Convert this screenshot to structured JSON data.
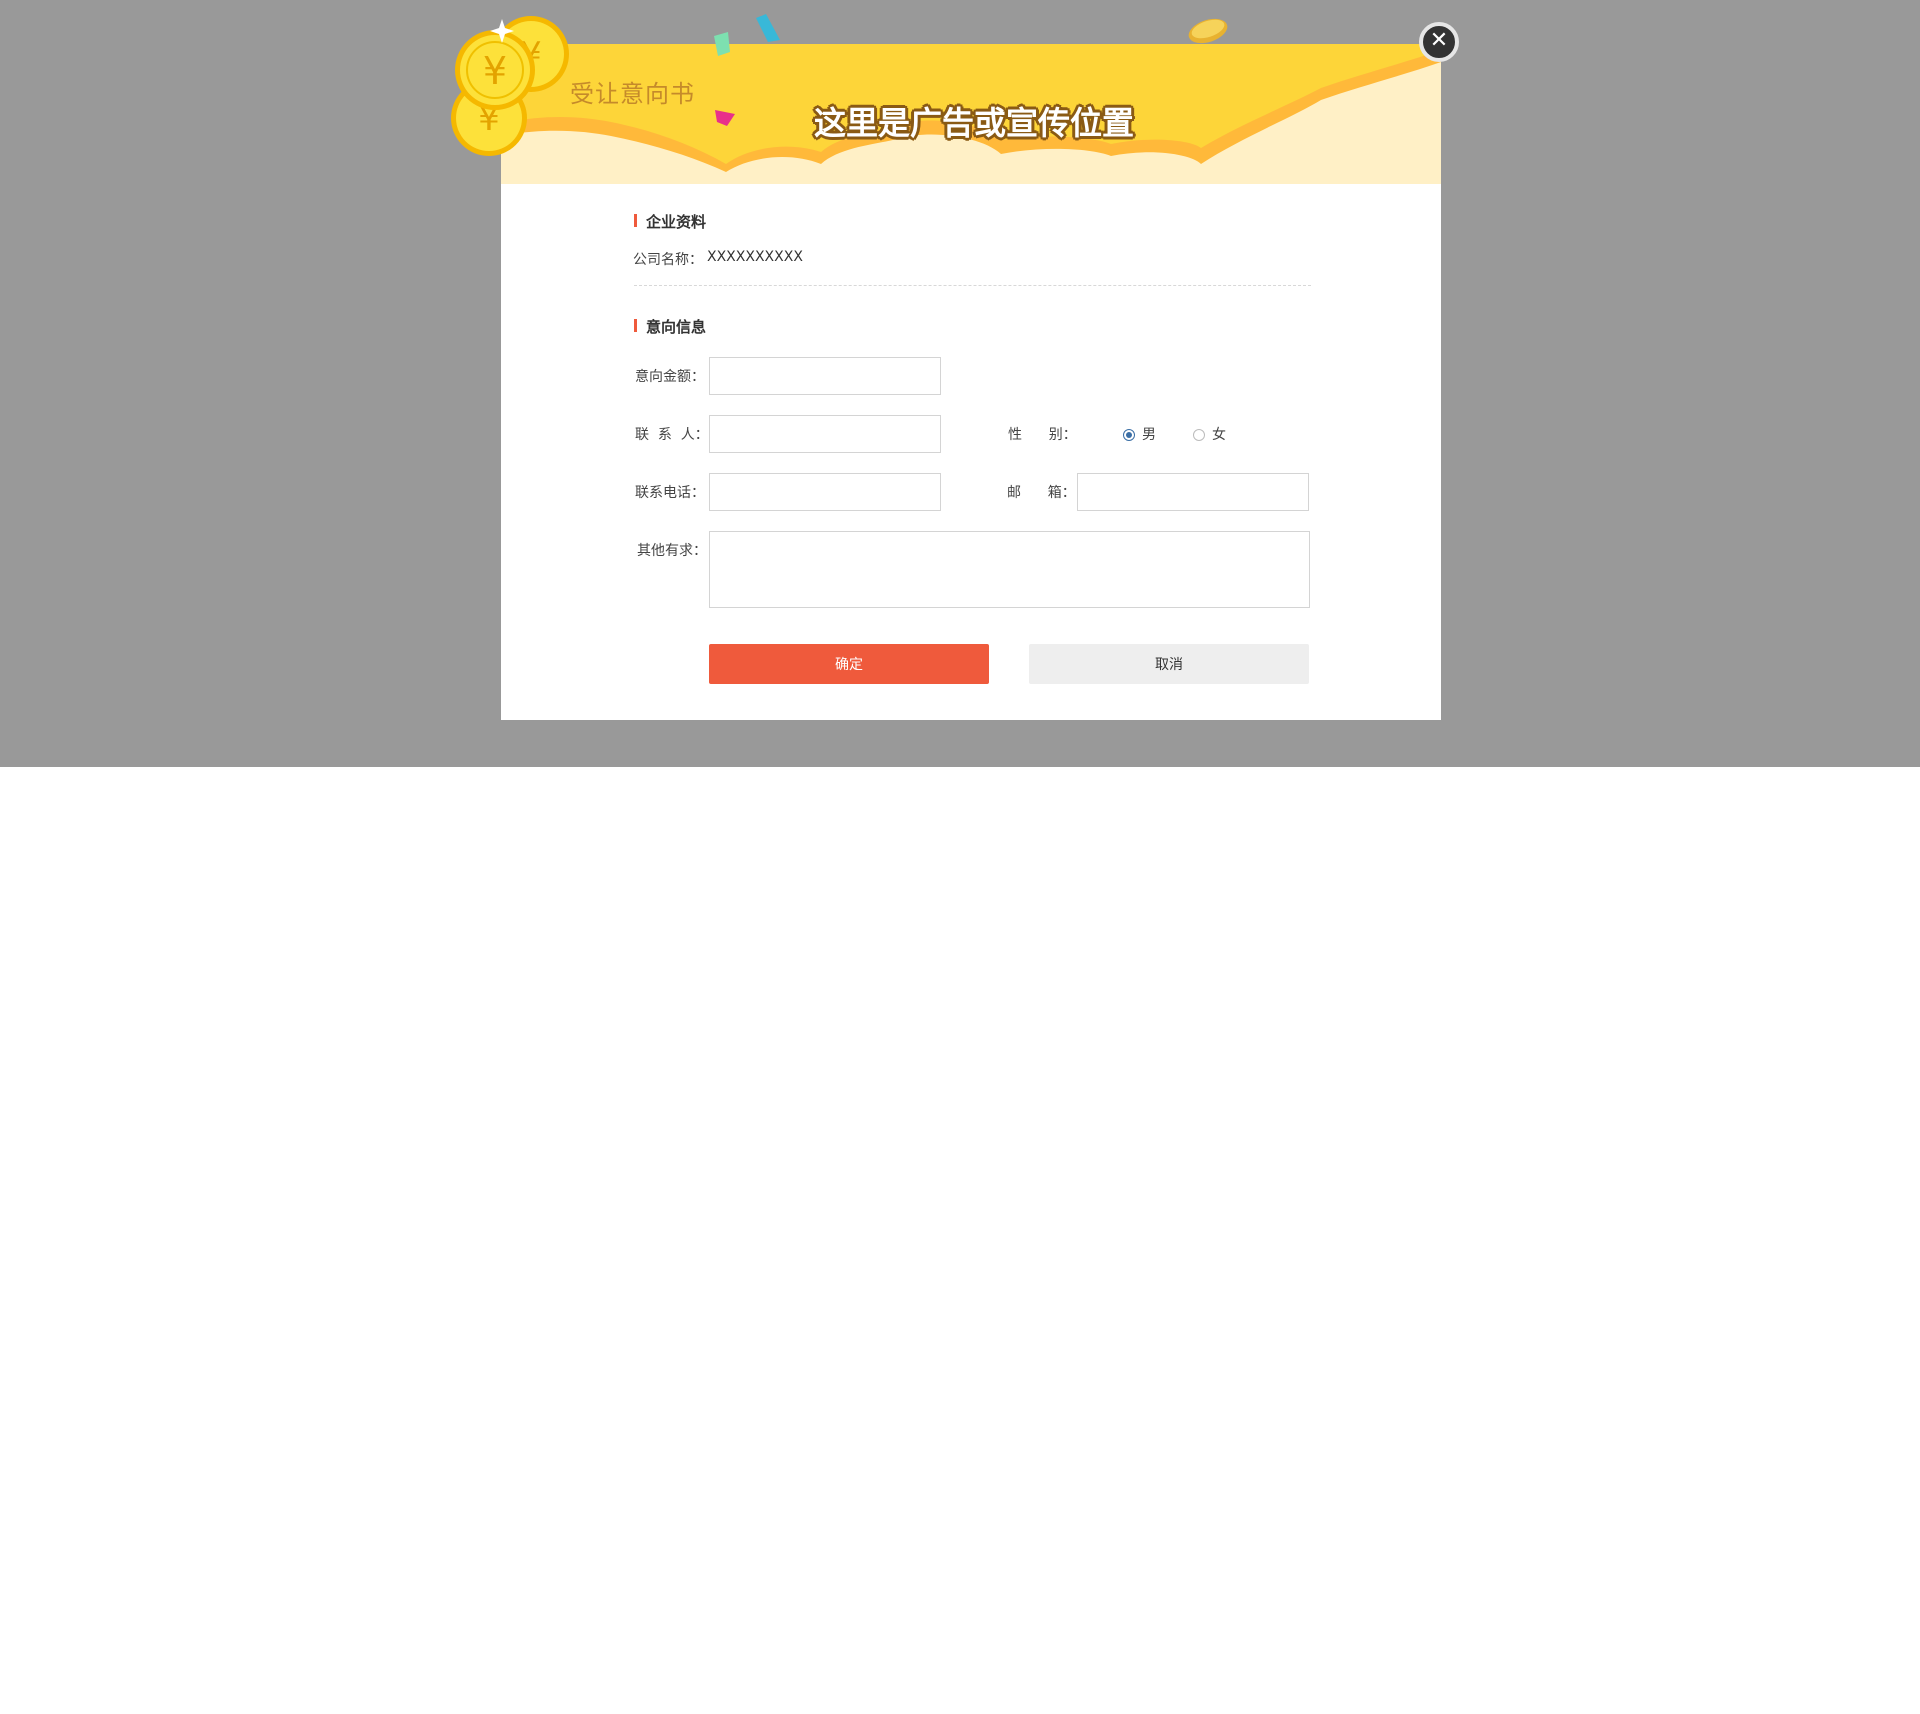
{
  "banner": {
    "title": "受让意向书",
    "ad_text": "这里是广告或宣传位置"
  },
  "close_button": {
    "label": "✕"
  },
  "company_section": {
    "title": "企业资料",
    "name_label": "公司名称：",
    "name_value": "XXXXXXXXXX"
  },
  "intent_section": {
    "title": "意向信息",
    "amount_label": "意向金额：",
    "contact_label": "联  系  人：",
    "gender_label": "性      别：",
    "gender_options": [
      {
        "label": "男",
        "checked": true
      },
      {
        "label": "女",
        "checked": false
      }
    ],
    "phone_label": "联系电话：",
    "email_label": "邮      箱：",
    "other_label": "其他有求："
  },
  "actions": {
    "confirm_label": "确定",
    "cancel_label": "取消"
  },
  "colors": {
    "overlay": "#999999",
    "banner_yellow": "#fdd539",
    "banner_cream": "#fff0c6",
    "accent_red": "#ef5a3c",
    "radio_blue": "#3a6ea5"
  },
  "icons": [
    "coin-icon",
    "close-icon",
    "confetti-icon"
  ]
}
